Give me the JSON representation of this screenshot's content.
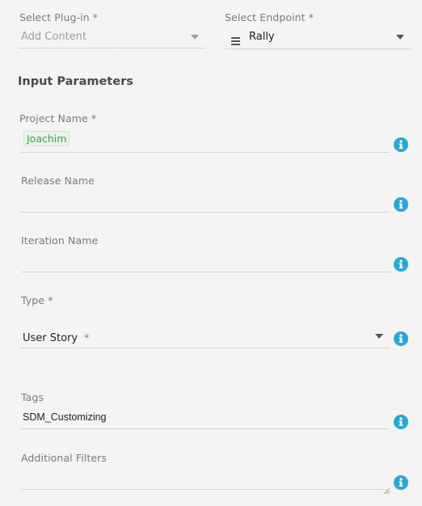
{
  "plugin": {
    "label": "Select Plug-in *",
    "placeholder": "Add Content"
  },
  "endpoint": {
    "label": "Select Endpoint *",
    "value": "Rally",
    "icon": "server-icon"
  },
  "section": {
    "title": "Input Parameters"
  },
  "project": {
    "label": "Project Name",
    "required_mark": "*",
    "chip": "Joachim"
  },
  "release": {
    "label": "Release Name",
    "value": ""
  },
  "iteration": {
    "label": "Iteration Name",
    "value": ""
  },
  "type": {
    "label": "Type *",
    "value": "User Story",
    "required_mark": "*"
  },
  "tags": {
    "label": "Tags",
    "value": "SDM_Customizing"
  },
  "filters": {
    "label": "Additional Filters",
    "value": ""
  },
  "colors": {
    "info": "#29a8d4",
    "chip_text": "#3aa24a",
    "background": "#f4f4f4"
  }
}
